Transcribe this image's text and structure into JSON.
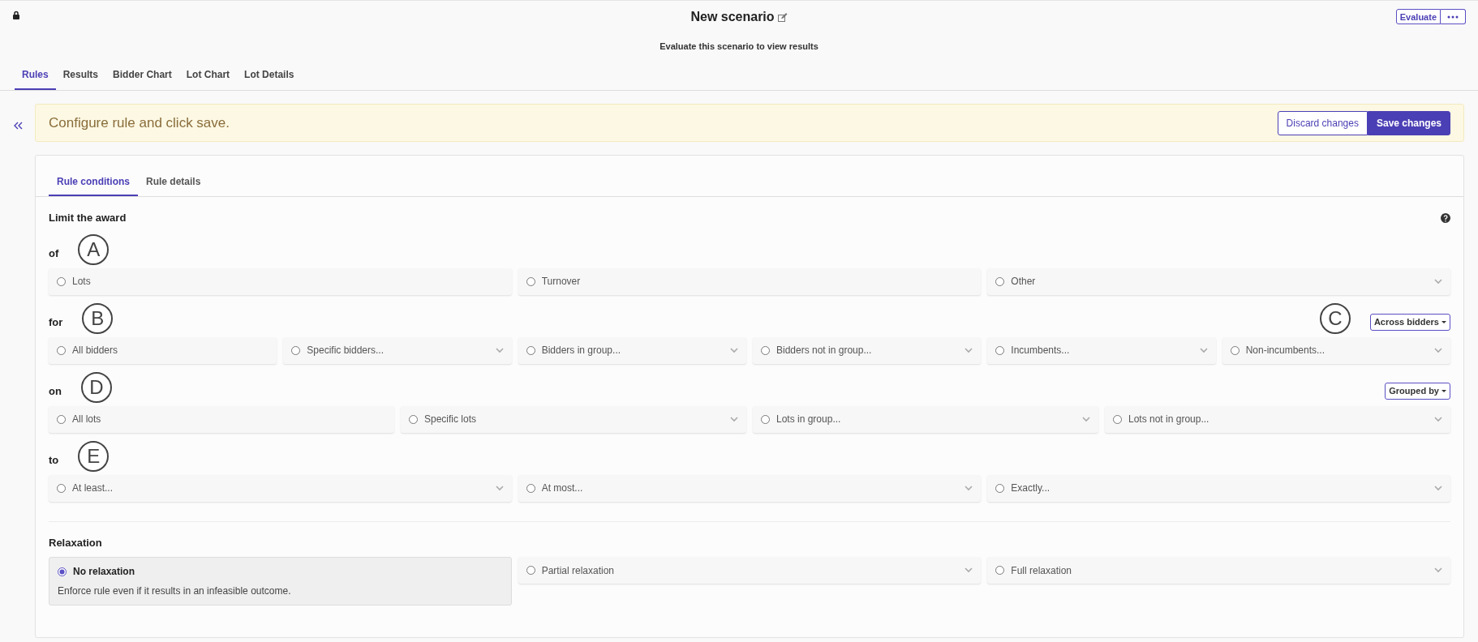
{
  "header": {
    "title": "New scenario",
    "subtitle": "Evaluate this scenario to view results",
    "evaluate_label": "Evaluate"
  },
  "tabs": [
    {
      "label": "Rules",
      "selected": true
    },
    {
      "label": "Results",
      "selected": false
    },
    {
      "label": "Bidder Chart",
      "selected": false
    },
    {
      "label": "Lot Chart",
      "selected": false
    },
    {
      "label": "Lot Details",
      "selected": false
    }
  ],
  "banner": {
    "message": "Configure rule and click save.",
    "buttons": [
      {
        "label": "Discard changes",
        "kind": "outline"
      },
      {
        "label": "Save changes",
        "kind": "primary"
      }
    ]
  },
  "rule_tabs": [
    {
      "label": "Rule conditions",
      "selected": true
    },
    {
      "label": "Rule details",
      "selected": false
    }
  ],
  "section_title": "Limit the award",
  "groups": [
    {
      "label": "of",
      "callout": "A",
      "options": [
        {
          "label": "Lots",
          "kind": "radio",
          "selected": false
        },
        {
          "label": "Turnover",
          "kind": "radio",
          "selected": false
        },
        {
          "label": "Other",
          "kind": "dropdown",
          "selected": false
        }
      ]
    },
    {
      "label": "for",
      "callout": "B",
      "side_callout": "C",
      "toggle": "Across bidders",
      "options": [
        {
          "label": "All bidders",
          "kind": "radio",
          "selected": false
        },
        {
          "label": "Specific bidders...",
          "kind": "dropdown",
          "selected": false
        },
        {
          "label": "Bidders in group...",
          "kind": "dropdown",
          "selected": false
        },
        {
          "label": "Bidders not in group...",
          "kind": "dropdown",
          "selected": false
        },
        {
          "label": "Incumbents...",
          "kind": "dropdown",
          "selected": false
        },
        {
          "label": "Non-incumbents...",
          "kind": "dropdown",
          "selected": false
        }
      ]
    },
    {
      "label": "on",
      "callout": "D",
      "toggle": "Grouped by",
      "options": [
        {
          "label": "All lots",
          "kind": "radio",
          "selected": false
        },
        {
          "label": "Specific lots",
          "kind": "dropdown",
          "selected": false
        },
        {
          "label": "Lots in group...",
          "kind": "dropdown",
          "selected": false
        },
        {
          "label": "Lots not in group...",
          "kind": "dropdown",
          "selected": false
        }
      ]
    },
    {
      "label": "to",
      "callout": "E",
      "options": [
        {
          "label": "At least...",
          "kind": "dropdown",
          "selected": false
        },
        {
          "label": "At most...",
          "kind": "dropdown",
          "selected": false
        },
        {
          "label": "Exactly...",
          "kind": "dropdown",
          "selected": false
        }
      ]
    }
  ],
  "relaxation": {
    "title": "Relaxation",
    "options": [
      {
        "label": "No relaxation",
        "description": "Enforce rule even if it results in an infeasible outcome.",
        "kind": "detailed",
        "selected": true
      },
      {
        "label": "Partial relaxation",
        "kind": "dropdown",
        "selected": false
      },
      {
        "label": "Full relaxation",
        "kind": "dropdown",
        "selected": false
      }
    ]
  }
}
